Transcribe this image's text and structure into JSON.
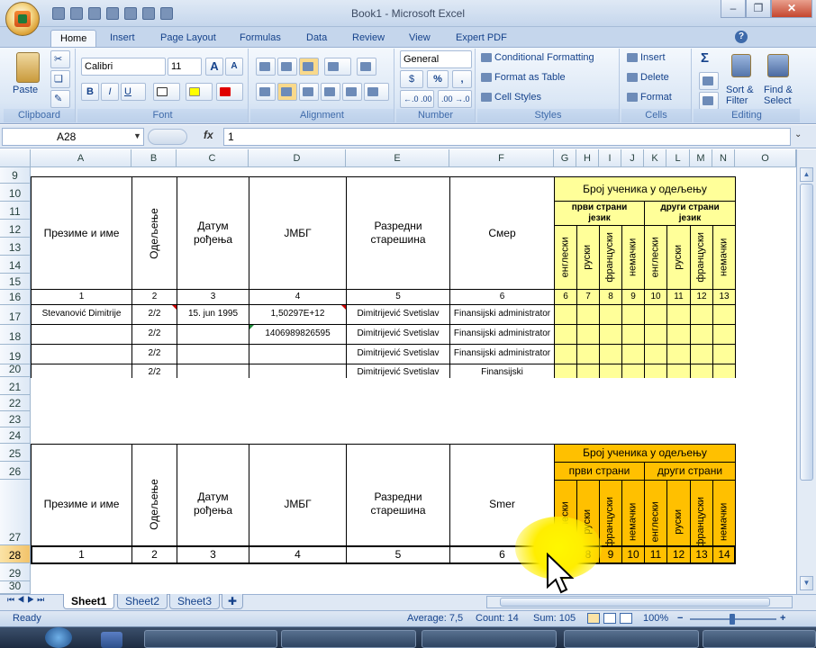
{
  "window": {
    "title": "Book1 - Microsoft Excel",
    "minimize": "–",
    "restore": "❐",
    "close": "✕"
  },
  "ribbon_tabs": [
    "Home",
    "Insert",
    "Page Layout",
    "Formulas",
    "Data",
    "Review",
    "View",
    "Expert PDF"
  ],
  "help_icon": "?",
  "clipboard": {
    "paste": "Paste",
    "label": "Clipboard"
  },
  "font": {
    "name": "Calibri",
    "size": "11",
    "grow": "A",
    "shrink": "A",
    "bold": "B",
    "italic": "I",
    "underline": "U",
    "label": "Font"
  },
  "alignment": {
    "label": "Alignment"
  },
  "number": {
    "format": "General",
    "currency": "$",
    "percent": "%",
    "comma": ",",
    "inc_dec": "←.0 .00",
    "dec_dec": ".00 →.0",
    "label": "Number"
  },
  "styles": {
    "conditional": "Conditional Formatting",
    "table": "Format as Table",
    "cell": "Cell Styles",
    "label": "Styles"
  },
  "cells": {
    "insert": "Insert",
    "delete": "Delete",
    "format": "Format",
    "label": "Cells"
  },
  "editing": {
    "sigma": "Σ",
    "sort": "Sort &",
    "sort2": "Filter",
    "find": "Find &",
    "find2": "Select",
    "label": "Editing"
  },
  "formula_bar": {
    "name_box": "A28",
    "fx": "fx",
    "value": "1"
  },
  "columns": [
    "A",
    "B",
    "C",
    "D",
    "E",
    "F",
    "G",
    "H",
    "I",
    "J",
    "K",
    "L",
    "M",
    "N",
    "O"
  ],
  "rows": [
    "9",
    "10",
    "11",
    "12",
    "13",
    "14",
    "15",
    "16",
    "17",
    "18",
    "19",
    "20",
    "21",
    "22",
    "23",
    "24",
    "25",
    "26",
    "27",
    "28",
    "29",
    "30"
  ],
  "table1": {
    "h_name": "Презиме и име",
    "h_dept": "Одељење",
    "h_dob": "Датум рођења",
    "h_jmbg": "ЈМБГ",
    "h_teacher": "Разредни старешина",
    "h_major": "Смер",
    "h_count": "Број ученика у одељењу",
    "h_first": "први страни језик",
    "h_second": "други страни језик",
    "langs": [
      "енглески",
      "руски",
      "француски",
      "немачки",
      "енглески",
      "руски",
      "француски",
      "немачки"
    ],
    "numbers": [
      "1",
      "2",
      "3",
      "4",
      "5",
      "6",
      "7",
      "8",
      "9",
      "10",
      "11",
      "12",
      "13"
    ],
    "rows": [
      {
        "name": "Stevanović Dimitrije",
        "dept": "2/2",
        "dob": "15. jun 1995",
        "jmbg": "1,50297E+12",
        "teacher": "Dimitrijević Svetislav",
        "major": "Finansijski administrator"
      },
      {
        "name": "",
        "dept": "2/2",
        "dob": "",
        "jmbg": "1406989826595",
        "teacher": "Dimitrijević Svetislav",
        "major": "Finansijski administrator"
      },
      {
        "name": "",
        "dept": "2/2",
        "dob": "",
        "jmbg": "",
        "teacher": "Dimitrijević Svetislav",
        "major": "Finansijski administrator"
      },
      {
        "name": "",
        "dept": "2/2",
        "dob": "",
        "jmbg": "",
        "teacher": "Dimitrijević Svetislav",
        "major": "Finansijski"
      }
    ]
  },
  "table2": {
    "h_name": "Презиме и име",
    "h_dept": "Одељење",
    "h_dob": "Датум рођења",
    "h_jmbg": "ЈМБГ",
    "h_teacher": "Разредни старешина",
    "h_major": "Smer",
    "h_count": "Број ученика у одељењу",
    "h_first": "први страни",
    "h_second": "други страни",
    "langs": [
      "енглески",
      "руски",
      "француски",
      "немачки",
      "енглески",
      "руски",
      "француски",
      "немачки"
    ],
    "numbers": [
      "1",
      "2",
      "3",
      "4",
      "5",
      "6",
      "7",
      "8",
      "9",
      "10",
      "11",
      "12",
      "13",
      "14"
    ]
  },
  "sheets": [
    "Sheet1",
    "Sheet2",
    "Sheet3"
  ],
  "status": {
    "ready": "Ready",
    "average": "Average: 7,5",
    "count": "Count: 14",
    "sum": "Sum: 105",
    "zoom": "100%"
  },
  "colors": {
    "yellow_fill": "#ffff99",
    "orange_fill": "#ffc000",
    "selection": "#f2c36a"
  }
}
